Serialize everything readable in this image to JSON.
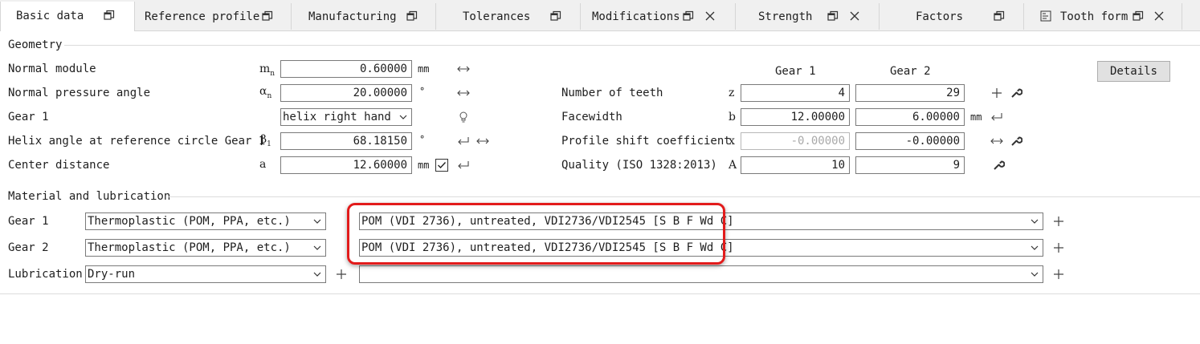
{
  "tabs": [
    {
      "label": "Basic data",
      "icon": "restore-window-icon",
      "closable": false,
      "active": true
    },
    {
      "label": "Reference profile",
      "icon": "restore-window-icon",
      "closable": false
    },
    {
      "label": "Manufacturing",
      "icon": "restore-window-icon",
      "closable": false
    },
    {
      "label": "Tolerances",
      "icon": "restore-window-icon",
      "closable": false
    },
    {
      "label": "Modifications",
      "icon": "restore-window-icon",
      "closable": true
    },
    {
      "label": "Strength",
      "icon": "restore-window-icon",
      "closable": true
    },
    {
      "label": "Factors",
      "icon": "restore-window-icon",
      "closable": false
    },
    {
      "label": "Tooth form",
      "icon": "restore-window-icon",
      "closable": true,
      "leading_icon": "tooth-form-icon"
    }
  ],
  "geometry": {
    "title": "Geometry",
    "normal_module": {
      "label": "Normal module",
      "symbol": "m",
      "sub": "n",
      "value": "0.60000",
      "unit": "mm"
    },
    "pressure_angle": {
      "label": "Normal pressure angle",
      "symbol": "α",
      "sub": "n",
      "value": "20.00000",
      "unit": "°"
    },
    "gear1_helix": {
      "label": "Gear 1",
      "value": "helix right hand"
    },
    "helix_angle": {
      "label": "Helix angle at reference circle Gear 1",
      "symbol": "β",
      "sub": "1",
      "value": "68.18150",
      "unit": "°"
    },
    "center_distance": {
      "label": "Center distance",
      "symbol": "a",
      "value": "12.60000",
      "unit": "mm",
      "checked": true
    },
    "col_gear1": "Gear 1",
    "col_gear2": "Gear 2",
    "details_button": "Details",
    "teeth": {
      "label": "Number of teeth",
      "symbol": "z",
      "g1": "4",
      "g2": "29"
    },
    "facewidth": {
      "label": "Facewidth",
      "symbol": "b",
      "g1": "12.00000",
      "g2": "6.00000",
      "unit": "mm"
    },
    "profile_shift": {
      "label": "Profile shift coefficient",
      "symbol": "x",
      "g1": "-0.00000",
      "g2": "-0.00000"
    },
    "quality": {
      "label": "Quality (ISO 1328:2013)",
      "symbol": "A",
      "g1": "10",
      "g2": "9"
    }
  },
  "material": {
    "title": "Material and lubrication",
    "gear1": {
      "label": "Gear 1",
      "type": "Thermoplastic (POM, PPA, etc.)",
      "material": "POM (VDI 2736), untreated, VDI2736/VDI2545 [S B F Wd C]"
    },
    "gear2": {
      "label": "Gear 2",
      "type": "Thermoplastic (POM, PPA, etc.)",
      "material": "POM (VDI 2736), untreated, VDI2736/VDI2545 [S B F Wd C]"
    },
    "lubrication": {
      "label": "Lubrication",
      "type": "Dry-run",
      "material": ""
    }
  },
  "colors": {
    "highlight": "#e21b1b",
    "accent": "#1e1e1e"
  }
}
